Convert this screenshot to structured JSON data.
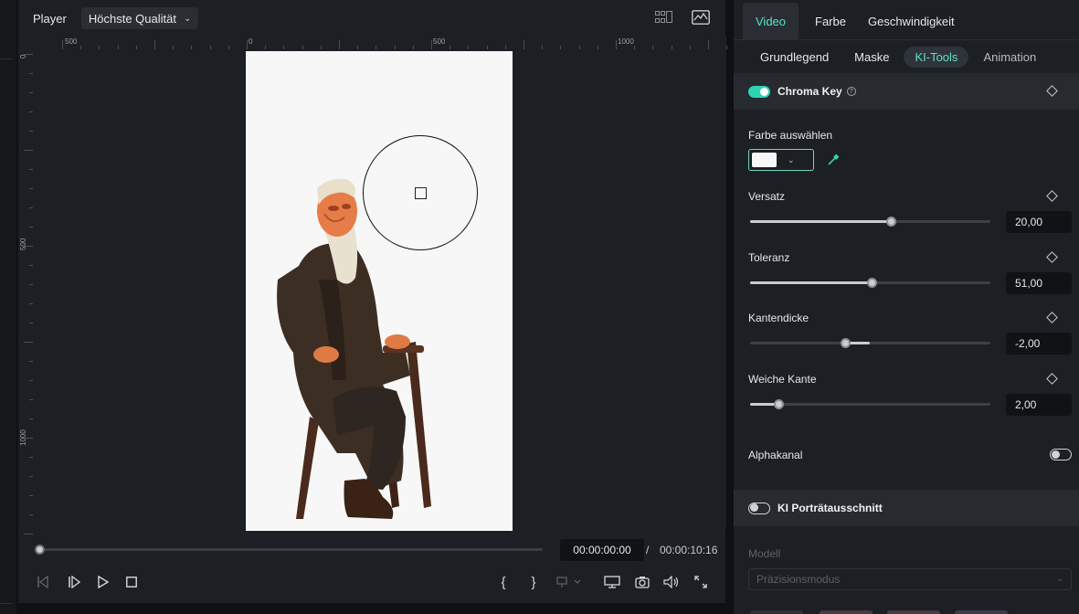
{
  "player": {
    "title": "Player",
    "quality": "Höchste Qualität",
    "ruler_h_labels": [
      "500",
      "0",
      "500",
      "1000"
    ],
    "ruler_v_labels": [
      "0",
      "500",
      "1000"
    ],
    "timecode_current": "00:00:00:00",
    "timecode_separator": "/",
    "timecode_total": "00:00:10:16",
    "progress": 0
  },
  "inspector": {
    "tabs": [
      "Video",
      "Farbe",
      "Geschwindigkeit"
    ],
    "active_tab": "Video",
    "subtabs": [
      "Grundlegend",
      "Maske",
      "KI-Tools",
      "Animation"
    ],
    "active_subtab": "KI-Tools",
    "chroma_key": {
      "title": "Chroma Key",
      "enabled": true,
      "color_label": "Farbe auswählen",
      "selected_color": "#f7f7f7",
      "sliders": [
        {
          "label": "Versatz",
          "value": "20,00",
          "fraction": 0.59
        },
        {
          "label": "Toleranz",
          "value": "51,00",
          "fraction": 0.51
        },
        {
          "label": "Kantendicke",
          "value": "-2,00",
          "fraction": 0.4,
          "center": 0.5
        },
        {
          "label": "Weiche Kante",
          "value": "2,00",
          "fraction": 0.12
        }
      ],
      "alpha_label": "Alphakanal",
      "alpha_enabled": false
    },
    "portrait": {
      "title": "KI Porträtausschnitt",
      "enabled": false,
      "model_label": "Modell",
      "model_value": "Präzisionsmodus"
    }
  },
  "colors": {
    "accent": "#2ed3b3",
    "accent_text": "#5ee0c6",
    "panel": "#1c1f23"
  }
}
